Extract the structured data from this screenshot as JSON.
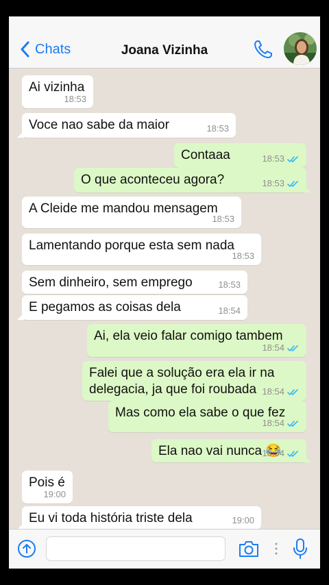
{
  "header": {
    "back_label": "Chats",
    "contact_name": "Joana Vizinha",
    "accent_color": "#1a7cf5"
  },
  "icons": {
    "back": "chevron-left-icon",
    "call": "phone-icon",
    "attach": "upload-arrow-icon",
    "camera": "camera-icon",
    "mic": "microphone-icon",
    "read_receipt": "double-check-icon"
  },
  "messages": [
    {
      "dir": "in",
      "text": "Ai vizinha",
      "time": "18:53"
    },
    {
      "dir": "in",
      "text": "Voce nao sabe da maior",
      "time": "18:53"
    },
    {
      "dir": "out",
      "text": "Contaaa",
      "time": "18:53",
      "read": true
    },
    {
      "dir": "out",
      "text": "O que aconteceu agora?",
      "time": "18:53",
      "read": true
    },
    {
      "dir": "in",
      "text": "A Cleide me mandou mensagem",
      "time": "18:53"
    },
    {
      "dir": "in",
      "text": "Lamentando porque esta sem nada",
      "time": "18:53"
    },
    {
      "dir": "in",
      "text": "Sem dinheiro, sem emprego",
      "time": "18:53"
    },
    {
      "dir": "in",
      "text": "E pegamos as coisas dela",
      "time": "18:54"
    },
    {
      "dir": "out",
      "text": "Ai, ela veio falar comigo tambem",
      "time": "18:54",
      "read": true
    },
    {
      "dir": "out",
      "text": "Falei que a solução era ela ir na delegacia, ja que foi roubada",
      "time": "18:54",
      "read": true
    },
    {
      "dir": "out",
      "text": "Mas como ela sabe o que fez",
      "time": "18:54",
      "read": true
    },
    {
      "dir": "out",
      "text": "Ela nao vai nunca 😂",
      "time": "18:54",
      "read": true
    },
    {
      "dir": "in",
      "text": "Pois é",
      "time": "19:00"
    },
    {
      "dir": "in",
      "text": "Eu vi toda história triste dela",
      "time": "19:00"
    }
  ],
  "input": {
    "placeholder": "",
    "value": ""
  },
  "colors": {
    "chat_background": "#e6e0d8",
    "incoming_bubble": "#ffffff",
    "outgoing_bubble": "#dcf8c6",
    "tick_color": "#34b7f1"
  }
}
